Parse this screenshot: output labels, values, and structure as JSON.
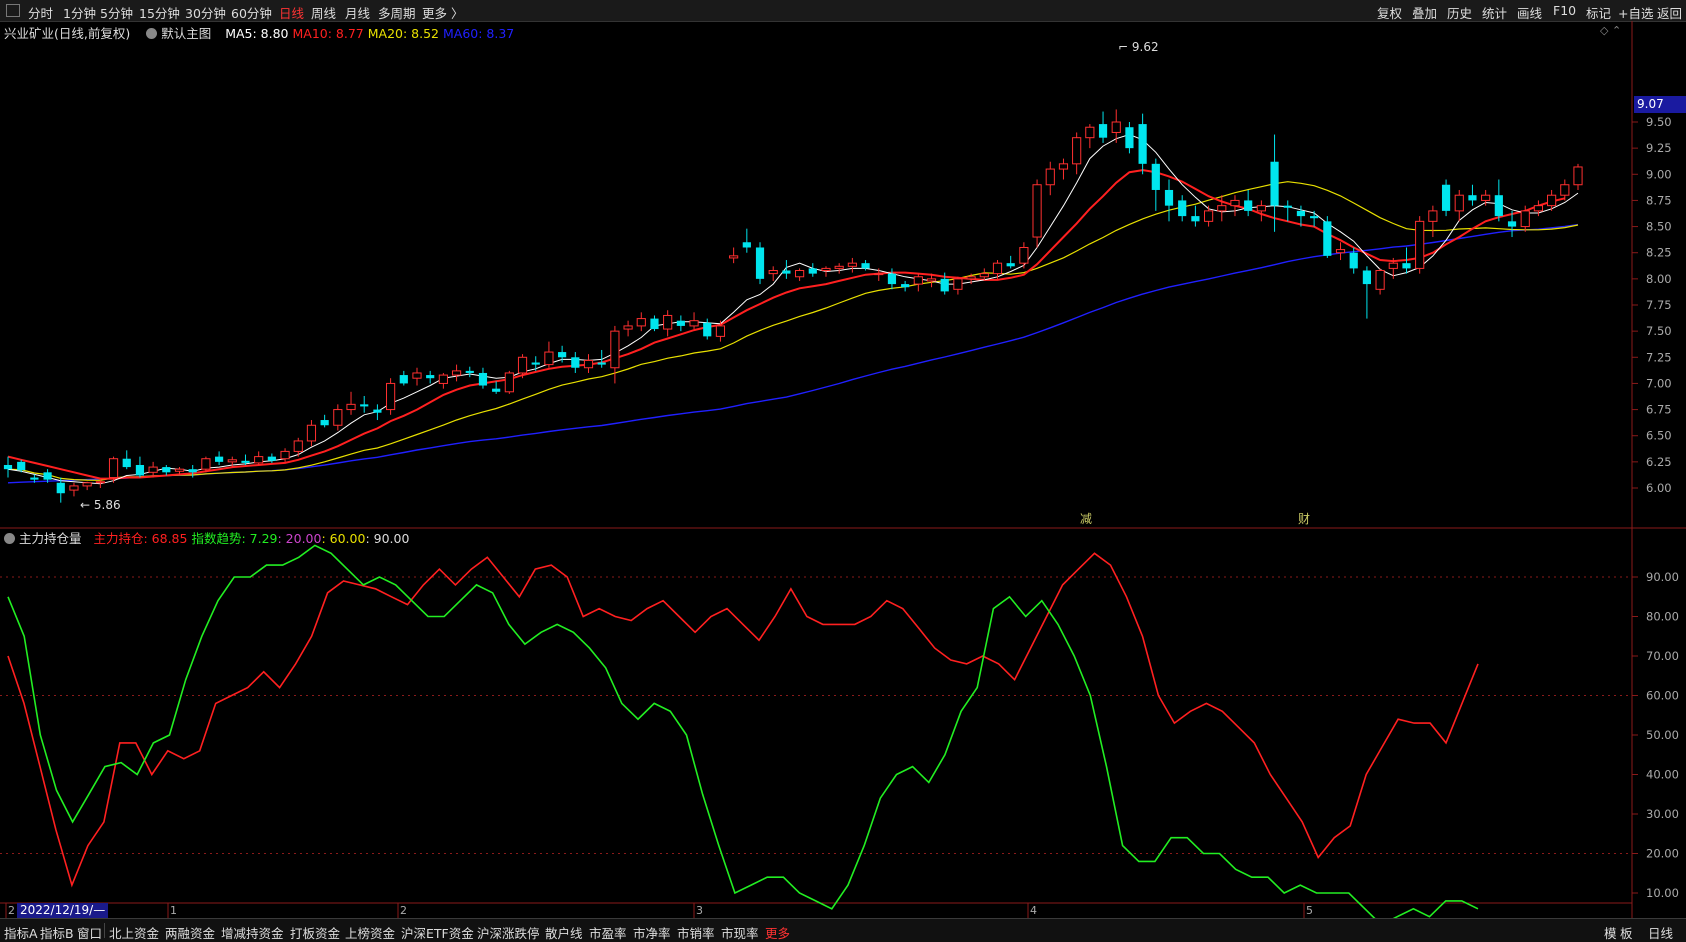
{
  "topbar": {
    "tabs": [
      "分时",
      "1分钟",
      "5分钟",
      "15分钟",
      "30分钟",
      "60分钟",
      "日线",
      "周线",
      "月线",
      "多周期",
      "更多 〉"
    ],
    "active_tab": "日线",
    "right_tabs": [
      "复权",
      "叠加",
      "历史",
      "统计",
      "画线",
      "F10",
      "标记",
      "+自选",
      "返回"
    ]
  },
  "main_legend": {
    "stock": "兴业矿业(日线,前复权)",
    "chart_name": "默认主图",
    "ma5": "MA5: 8.80",
    "ma10": "MA10: 8.77",
    "ma20": "MA20: 8.52",
    "ma60": "MA60: 8.37",
    "colors": {
      "ma5": "#ffffff",
      "ma10": "#ff2020",
      "ma20": "#e8e000",
      "ma60": "#2020ff"
    }
  },
  "indicator_legend": {
    "name": "主力持仓量",
    "main_hold": "主力持仓: 68.85",
    "trend": "指数趋势: 7.29",
    "l20": ": 20.00",
    "l60": ": 60.00",
    "l90": ": 90.00"
  },
  "price_axis": [
    "9.50",
    "9.25",
    "9.00",
    "8.75",
    "8.50",
    "8.25",
    "8.00",
    "7.75",
    "7.50",
    "7.25",
    "7.00",
    "6.75",
    "6.50",
    "6.25",
    "6.00"
  ],
  "indicator_axis": [
    "90.00",
    "80.00",
    "70.00",
    "60.00",
    "50.00",
    "40.00",
    "30.00",
    "20.00",
    "10.00"
  ],
  "current_price": "9.07",
  "high_annot": "9.62",
  "low_annot": "5.86",
  "event_marks": [
    "减",
    "财"
  ],
  "month_marks": [
    "2",
    "1",
    "2",
    "3",
    "4",
    "5"
  ],
  "cursor_date": "2022/12/19/—",
  "bottom_tabs": [
    "指标A",
    "指标B",
    "窗口",
    "北上资金",
    "两融资金",
    "增减持资金",
    "打板资金",
    "上榜资金",
    "沪深ETF资金",
    "沪深涨跌停",
    "散户线",
    "市盈率",
    "市净率",
    "市销率",
    "市现率",
    "更多"
  ],
  "bottom_right": [
    "模",
    "板",
    "日线"
  ],
  "chart_data": {
    "type": "candlestick",
    "title": "兴业矿业(日线,前复权)",
    "ylim": [
      5.8,
      9.7
    ],
    "candles": [
      [
        6.22,
        6.3,
        6.1,
        6.18
      ],
      [
        6.25,
        6.27,
        6.15,
        6.17
      ],
      [
        6.1,
        6.13,
        6.05,
        6.08
      ],
      [
        6.15,
        6.18,
        6.05,
        6.08
      ],
      [
        6.05,
        6.1,
        5.86,
        5.95
      ],
      [
        5.98,
        6.05,
        5.92,
        6.02
      ],
      [
        6.02,
        6.06,
        5.98,
        6.05
      ],
      [
        6.05,
        6.08,
        6.0,
        6.06
      ],
      [
        6.1,
        6.3,
        6.05,
        6.28
      ],
      [
        6.28,
        6.36,
        6.18,
        6.2
      ],
      [
        6.22,
        6.3,
        6.1,
        6.12
      ],
      [
        6.15,
        6.25,
        6.1,
        6.2
      ],
      [
        6.2,
        6.22,
        6.12,
        6.15
      ],
      [
        6.16,
        6.2,
        6.12,
        6.18
      ],
      [
        6.18,
        6.22,
        6.1,
        6.15
      ],
      [
        6.18,
        6.3,
        6.15,
        6.28
      ],
      [
        6.3,
        6.35,
        6.22,
        6.25
      ],
      [
        6.25,
        6.3,
        6.2,
        6.27
      ],
      [
        6.26,
        6.32,
        6.22,
        6.24
      ],
      [
        6.24,
        6.35,
        6.22,
        6.3
      ],
      [
        6.3,
        6.33,
        6.24,
        6.26
      ],
      [
        6.28,
        6.38,
        6.25,
        6.35
      ],
      [
        6.35,
        6.48,
        6.3,
        6.45
      ],
      [
        6.45,
        6.65,
        6.4,
        6.6
      ],
      [
        6.65,
        6.7,
        6.58,
        6.6
      ],
      [
        6.6,
        6.8,
        6.55,
        6.75
      ],
      [
        6.75,
        6.92,
        6.7,
        6.8
      ],
      [
        6.8,
        6.88,
        6.72,
        6.78
      ],
      [
        6.75,
        6.8,
        6.65,
        6.72
      ],
      [
        6.75,
        7.05,
        6.7,
        7.0
      ],
      [
        7.08,
        7.12,
        6.98,
        7.0
      ],
      [
        7.05,
        7.15,
        6.98,
        7.1
      ],
      [
        7.08,
        7.12,
        7.0,
        7.05
      ],
      [
        7.0,
        7.1,
        6.95,
        7.08
      ],
      [
        7.08,
        7.18,
        7.02,
        7.12
      ],
      [
        7.12,
        7.16,
        7.06,
        7.1
      ],
      [
        7.1,
        7.15,
        6.95,
        6.98
      ],
      [
        6.95,
        7.02,
        6.9,
        6.92
      ],
      [
        6.92,
        7.12,
        6.9,
        7.1
      ],
      [
        7.1,
        7.28,
        7.05,
        7.25
      ],
      [
        7.2,
        7.26,
        7.12,
        7.18
      ],
      [
        7.18,
        7.4,
        7.15,
        7.3
      ],
      [
        7.3,
        7.36,
        7.2,
        7.25
      ],
      [
        7.25,
        7.3,
        7.1,
        7.15
      ],
      [
        7.15,
        7.28,
        7.1,
        7.22
      ],
      [
        7.2,
        7.32,
        7.15,
        7.18
      ],
      [
        7.15,
        7.55,
        7.0,
        7.5
      ],
      [
        7.52,
        7.6,
        7.45,
        7.55
      ],
      [
        7.55,
        7.68,
        7.5,
        7.62
      ],
      [
        7.62,
        7.65,
        7.5,
        7.52
      ],
      [
        7.52,
        7.7,
        7.45,
        7.65
      ],
      [
        7.6,
        7.65,
        7.5,
        7.55
      ],
      [
        7.55,
        7.68,
        7.52,
        7.6
      ],
      [
        7.58,
        7.62,
        7.42,
        7.45
      ],
      [
        7.45,
        7.6,
        7.4,
        7.55
      ],
      [
        8.2,
        8.3,
        8.15,
        8.22
      ],
      [
        8.35,
        8.48,
        8.25,
        8.3
      ],
      [
        8.3,
        8.35,
        7.95,
        8.0
      ],
      [
        8.05,
        8.12,
        7.98,
        8.08
      ],
      [
        8.08,
        8.18,
        8.0,
        8.05
      ],
      [
        8.02,
        8.1,
        7.98,
        8.08
      ],
      [
        8.1,
        8.15,
        8.02,
        8.05
      ],
      [
        8.08,
        8.12,
        8.02,
        8.1
      ],
      [
        8.1,
        8.15,
        8.05,
        8.12
      ],
      [
        8.12,
        8.2,
        8.06,
        8.15
      ],
      [
        8.15,
        8.18,
        8.08,
        8.1
      ],
      [
        8.05,
        8.1,
        7.98,
        8.05
      ],
      [
        8.05,
        8.1,
        7.9,
        7.95
      ],
      [
        7.95,
        7.98,
        7.88,
        7.92
      ],
      [
        7.95,
        8.05,
        7.88,
        8.02
      ],
      [
        7.98,
        8.05,
        7.92,
        8.0
      ],
      [
        8.0,
        8.06,
        7.85,
        7.88
      ],
      [
        7.9,
        8.02,
        7.85,
        8.0
      ],
      [
        8.0,
        8.05,
        7.95,
        8.02
      ],
      [
        8.02,
        8.1,
        7.98,
        8.05
      ],
      [
        8.05,
        8.18,
        8.0,
        8.15
      ],
      [
        8.15,
        8.22,
        8.1,
        8.12
      ],
      [
        8.15,
        8.35,
        8.1,
        8.3
      ],
      [
        8.4,
        8.95,
        8.3,
        8.9
      ],
      [
        8.9,
        9.12,
        8.8,
        9.05
      ],
      [
        9.05,
        9.15,
        8.95,
        9.1
      ],
      [
        9.1,
        9.4,
        9.0,
        9.35
      ],
      [
        9.35,
        9.48,
        9.25,
        9.45
      ],
      [
        9.48,
        9.6,
        9.3,
        9.35
      ],
      [
        9.4,
        9.62,
        9.3,
        9.5
      ],
      [
        9.45,
        9.5,
        9.2,
        9.25
      ],
      [
        9.48,
        9.58,
        9.0,
        9.1
      ],
      [
        9.1,
        9.15,
        8.65,
        8.85
      ],
      [
        8.85,
        8.95,
        8.55,
        8.7
      ],
      [
        8.75,
        8.8,
        8.55,
        8.6
      ],
      [
        8.6,
        8.7,
        8.5,
        8.55
      ],
      [
        8.55,
        8.7,
        8.5,
        8.65
      ],
      [
        8.65,
        8.8,
        8.55,
        8.7
      ],
      [
        8.7,
        8.8,
        8.6,
        8.75
      ],
      [
        8.75,
        8.85,
        8.6,
        8.65
      ],
      [
        8.65,
        8.75,
        8.55,
        8.7
      ],
      [
        9.12,
        9.38,
        8.45,
        8.7
      ],
      [
        8.7,
        8.75,
        8.55,
        8.68
      ],
      [
        8.65,
        8.7,
        8.5,
        8.6
      ],
      [
        8.6,
        8.65,
        8.5,
        8.58
      ],
      [
        8.55,
        8.6,
        8.2,
        8.22
      ],
      [
        8.25,
        8.35,
        8.18,
        8.28
      ],
      [
        8.25,
        8.3,
        8.05,
        8.1
      ],
      [
        8.08,
        8.12,
        7.62,
        7.95
      ],
      [
        7.9,
        8.1,
        7.85,
        8.08
      ],
      [
        8.1,
        8.2,
        8.0,
        8.15
      ],
      [
        8.15,
        8.3,
        8.05,
        8.1
      ],
      [
        8.1,
        8.6,
        8.05,
        8.55
      ],
      [
        8.55,
        8.7,
        8.4,
        8.65
      ],
      [
        8.9,
        8.95,
        8.6,
        8.65
      ],
      [
        8.65,
        8.85,
        8.55,
        8.8
      ],
      [
        8.8,
        8.9,
        8.7,
        8.75
      ],
      [
        8.75,
        8.85,
        8.7,
        8.8
      ],
      [
        8.8,
        8.95,
        8.55,
        8.6
      ],
      [
        8.55,
        8.65,
        8.4,
        8.5
      ],
      [
        8.5,
        8.7,
        8.45,
        8.65
      ],
      [
        8.65,
        8.75,
        8.6,
        8.7
      ],
      [
        8.7,
        8.85,
        8.65,
        8.8
      ],
      [
        8.8,
        8.95,
        8.75,
        8.9
      ],
      [
        8.9,
        9.1,
        8.85,
        9.07
      ]
    ],
    "ma5": [
      6.18,
      6.16,
      6.13,
      6.1,
      6.07,
      6.06,
      6.05,
      6.04,
      6.07,
      6.12,
      6.13,
      6.16,
      6.19,
      6.18,
      6.16,
      6.19,
      6.2,
      6.22,
      6.23,
      6.25,
      6.26,
      6.28,
      6.32,
      6.39,
      6.45,
      6.53,
      6.62,
      6.7,
      6.73,
      6.81,
      6.86,
      6.92,
      6.98,
      7.05,
      7.07,
      7.09,
      7.07,
      7.05,
      7.06,
      7.11,
      7.14,
      7.19,
      7.23,
      7.23,
      7.22,
      7.23,
      7.29,
      7.36,
      7.44,
      7.55,
      7.57,
      7.59,
      7.59,
      7.58,
      7.57,
      7.68,
      7.8,
      7.85,
      7.95,
      8.11,
      8.15,
      8.1,
      8.07,
      8.08,
      8.1,
      8.1,
      8.08,
      8.05,
      8.02,
      8.0,
      7.98,
      7.95,
      7.95,
      7.97,
      7.99,
      8.02,
      8.07,
      8.13,
      8.3,
      8.5,
      8.7,
      8.92,
      9.15,
      9.27,
      9.34,
      9.38,
      9.33,
      9.21,
      9.05,
      8.9,
      8.78,
      8.67,
      8.64,
      8.65,
      8.68,
      8.69,
      8.7,
      8.69,
      8.66,
      8.63,
      8.53,
      8.45,
      8.36,
      8.22,
      8.09,
      8.03,
      8.06,
      8.11,
      8.22,
      8.37,
      8.56,
      8.66,
      8.73,
      8.72,
      8.66,
      8.63,
      8.63,
      8.67,
      8.73,
      8.82
    ],
    "ma10": [
      6.3,
      6.27,
      6.24,
      6.21,
      6.18,
      6.15,
      6.12,
      6.09,
      6.09,
      6.1,
      6.1,
      6.11,
      6.12,
      6.13,
      6.14,
      6.16,
      6.18,
      6.2,
      6.21,
      6.22,
      6.23,
      6.24,
      6.27,
      6.31,
      6.35,
      6.4,
      6.46,
      6.52,
      6.57,
      6.64,
      6.69,
      6.75,
      6.82,
      6.89,
      6.94,
      6.98,
      7.0,
      7.02,
      7.04,
      7.08,
      7.11,
      7.14,
      7.16,
      7.17,
      7.18,
      7.2,
      7.24,
      7.28,
      7.33,
      7.39,
      7.43,
      7.47,
      7.51,
      7.54,
      7.56,
      7.63,
      7.7,
      7.76,
      7.82,
      7.87,
      7.91,
      7.93,
      7.95,
      7.98,
      8.01,
      8.04,
      8.05,
      8.06,
      8.06,
      8.05,
      8.04,
      8.02,
      8.01,
      8.0,
      7.99,
      7.99,
      8.01,
      8.04,
      8.14,
      8.27,
      8.4,
      8.53,
      8.67,
      8.79,
      8.92,
      9.02,
      9.04,
      9.02,
      8.98,
      8.93,
      8.86,
      8.79,
      8.74,
      8.7,
      8.67,
      8.62,
      8.58,
      8.55,
      8.52,
      8.5,
      8.43,
      8.37,
      8.3,
      8.24,
      8.18,
      8.17,
      8.18,
      8.2,
      8.25,
      8.33,
      8.4,
      8.48,
      8.55,
      8.59,
      8.62,
      8.65,
      8.7,
      8.74,
      8.77
    ]
  }
}
